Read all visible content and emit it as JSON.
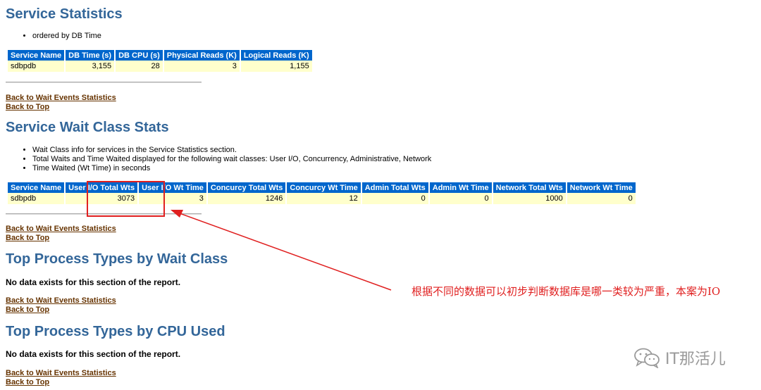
{
  "sections": {
    "service_stats": {
      "title": "Service Statistics",
      "notes": [
        "ordered by DB Time"
      ],
      "headers": [
        "Service Name",
        "DB Time (s)",
        "DB CPU (s)",
        "Physical Reads (K)",
        "Logical Reads (K)"
      ],
      "row": [
        "sdbpdb",
        "3,155",
        "28",
        "3",
        "1,155"
      ]
    },
    "wait_class": {
      "title": "Service Wait Class Stats",
      "notes": [
        "Wait Class info for services in the Service Statistics section.",
        "Total Waits and Time Waited displayed for the following wait classes: User I/O, Concurrency, Administrative, Network",
        "Time Waited (Wt Time) in seconds"
      ],
      "headers": [
        "Service Name",
        "User I/O Total Wts",
        "User I/O Wt Time",
        "Concurcy Total Wts",
        "Concurcy Wt Time",
        "Admin Total Wts",
        "Admin Wt Time",
        "Network Total Wts",
        "Network Wt Time"
      ],
      "row": [
        "sdbpdb",
        "3073",
        "3",
        "1246",
        "12",
        "0",
        "0",
        "1000",
        "0"
      ]
    },
    "process_wait": {
      "title": "Top Process Types by Wait Class",
      "message": "No data exists for this section of the report."
    },
    "process_cpu": {
      "title": "Top Process Types by CPU Used",
      "message": "No data exists for this section of the report."
    }
  },
  "links": {
    "back_wait": "Back to Wait Events Statistics",
    "back_top": "Back to Top"
  },
  "annotation": {
    "text": "根据不同的数据可以初步判断数据库是哪一类较为严重，本案为IO",
    "color": "#e02020"
  },
  "watermark": {
    "text": "IT那活儿",
    "icon": "wechat-icon"
  },
  "colors": {
    "heading": "#336699",
    "table_header_bg": "#0066CC",
    "table_cell_bg": "#FFFFCC",
    "link": "#663300"
  }
}
